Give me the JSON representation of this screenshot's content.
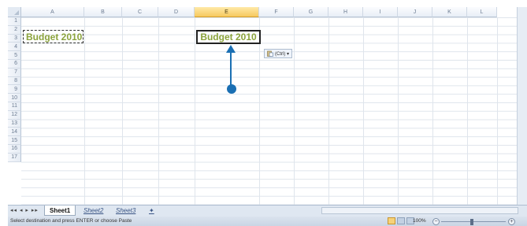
{
  "columns": [
    "A",
    "B",
    "C",
    "D",
    "E",
    "F",
    "G",
    "H",
    "I",
    "J",
    "K",
    "L"
  ],
  "selected_column": "E",
  "rows": [
    "1",
    "2",
    "3",
    "4",
    "5",
    "6",
    "7",
    "8",
    "9",
    "10",
    "11",
    "12",
    "13",
    "14",
    "15",
    "16",
    "17"
  ],
  "cells": {
    "A2": "Budget 2010",
    "E2": "Budget 2010"
  },
  "paste_options_label": "(Ctrl) ▾",
  "sheet_tabs": [
    "Sheet1",
    "Sheet2",
    "Sheet3"
  ],
  "active_sheet": "Sheet1",
  "status_text": "Select destination and press ENTER or choose Paste",
  "zoom_level": "100%",
  "colors": {
    "cell_text": "#8ba33c",
    "arrow": "#1a6fb3"
  },
  "icons": [
    "paste-options-icon",
    "sheet-nav-icon",
    "new-sheet-icon",
    "normal-view-icon",
    "page-layout-icon",
    "page-break-icon",
    "zoom-out-icon",
    "zoom-in-icon"
  ]
}
